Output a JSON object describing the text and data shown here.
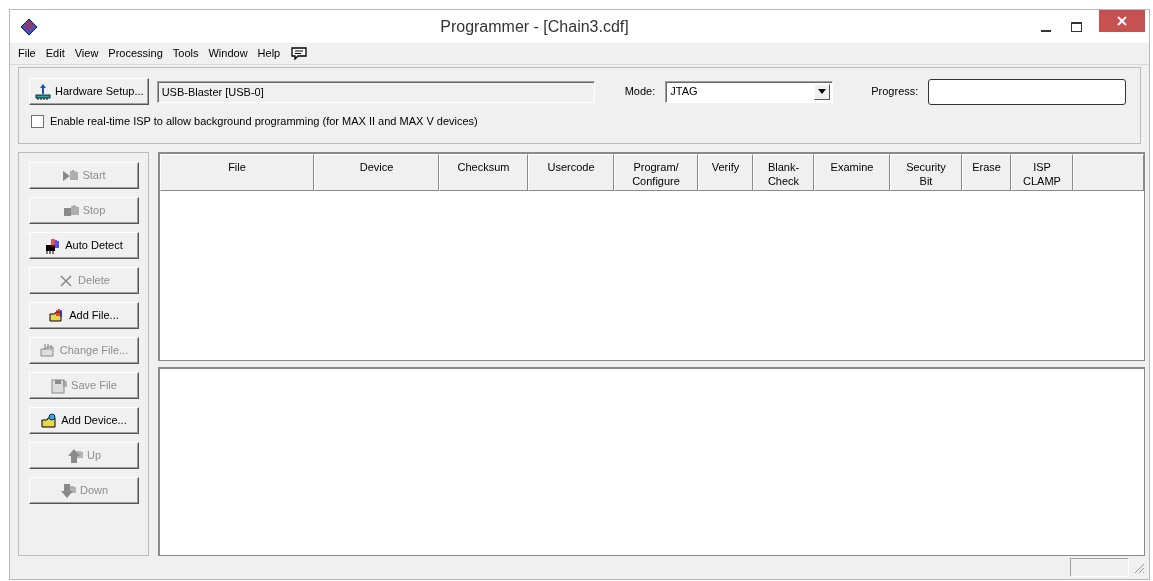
{
  "window": {
    "title": "Programmer - [Chain3.cdf]"
  },
  "menu": [
    "File",
    "Edit",
    "View",
    "Processing",
    "Tools",
    "Window",
    "Help"
  ],
  "hardware": {
    "button": "Hardware Setup...",
    "value": "USB-Blaster [USB-0]"
  },
  "mode": {
    "label": "Mode:",
    "value": "JTAG"
  },
  "progress": {
    "label": "Progress:",
    "level": 0
  },
  "realtime_isp": {
    "label": "Enable real-time ISP to allow background programming (for MAX II and MAX V devices)",
    "checked": false
  },
  "buttons": [
    {
      "label": "Start",
      "disabled": true
    },
    {
      "label": "Stop",
      "disabled": true
    },
    {
      "label": "Auto Detect",
      "disabled": false
    },
    {
      "label": "Delete",
      "disabled": true
    },
    {
      "label": "Add File...",
      "disabled": false
    },
    {
      "label": "Change File...",
      "disabled": true
    },
    {
      "label": "Save File",
      "disabled": true
    },
    {
      "label": "Add Device...",
      "disabled": false
    },
    {
      "label": "Up",
      "disabled": true
    },
    {
      "label": "Down",
      "disabled": true
    }
  ],
  "table": {
    "columns": [
      "File",
      "Device",
      "Checksum",
      "Usercode",
      "Program/\nConfigure",
      "Verify",
      "Blank-\nCheck",
      "Examine",
      "Security\nBit",
      "Erase",
      "ISP\nCLAMP"
    ]
  }
}
